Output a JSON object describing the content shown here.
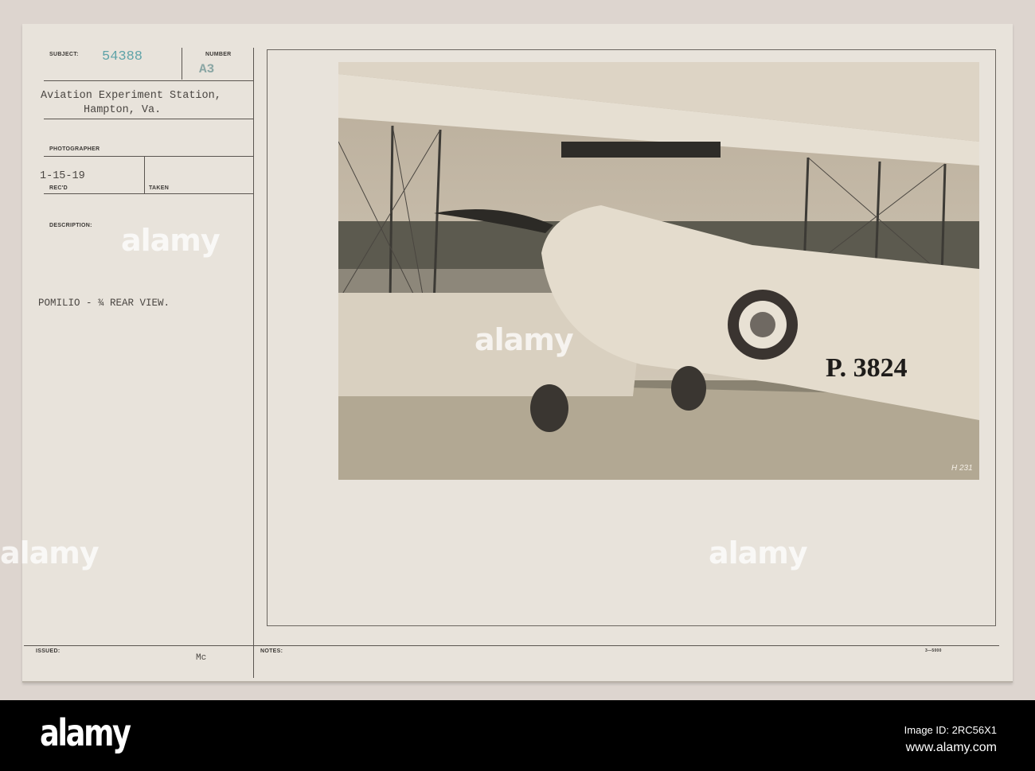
{
  "card": {
    "subject_label": "SUBJECT:",
    "subject_number": "54388",
    "number_label": "NUMBER",
    "number_value": "A3",
    "location_line1": "Aviation Experiment Station,",
    "location_line2": "Hampton, Va.",
    "photographer_label": "PHOTOGRAPHER",
    "date_value": "1-15-19",
    "recd_label": "REC'D",
    "taken_label": "TAKEN",
    "description_label": "DESCRIPTION:",
    "description_value": "POMILIO - ¾ REAR VIEW.",
    "issued_label": "ISSUED:",
    "issued_value": "Mc",
    "notes_label": "NOTES:",
    "form_code": "3—5000"
  },
  "photo": {
    "aircraft_marking": "P. 3824",
    "negative_code": "H 231"
  },
  "watermark": "alamy",
  "footer": {
    "logo": "alamy",
    "image_id": "Image ID: 2RC56X1",
    "url": "www.alamy.com"
  },
  "colors": {
    "subject_number": "#5fa3a8",
    "card": "#e8e3db",
    "roundel": "#3a3430"
  }
}
